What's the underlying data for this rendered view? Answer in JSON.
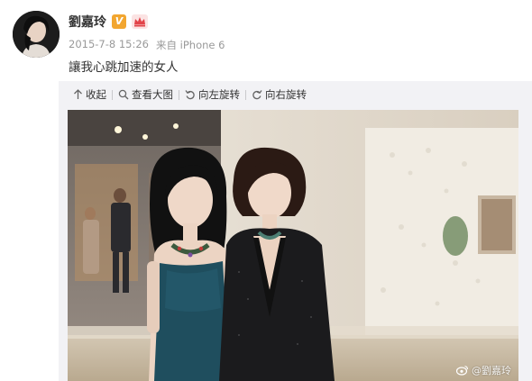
{
  "post": {
    "author_name": "劉嘉玲",
    "verified_badge": "V",
    "timestamp": "2015-7-8 15:26",
    "source_prefix": "来自",
    "device": "iPhone 6",
    "text": "讓我心跳加速的女人"
  },
  "toolbar": {
    "items": [
      {
        "label": "收起",
        "icon": "collapse-icon"
      },
      {
        "label": "查看大图",
        "icon": "zoom-icon"
      },
      {
        "label": "向左旋转",
        "icon": "rotate-left-icon"
      },
      {
        "label": "向右旋转",
        "icon": "rotate-right-icon"
      }
    ]
  },
  "photo": {
    "watermark": "@劉嘉玲"
  },
  "colors": {
    "badge_orange": "#f2a630",
    "toolbar_bg": "#f2f2f5",
    "meta_gray": "#999999"
  }
}
